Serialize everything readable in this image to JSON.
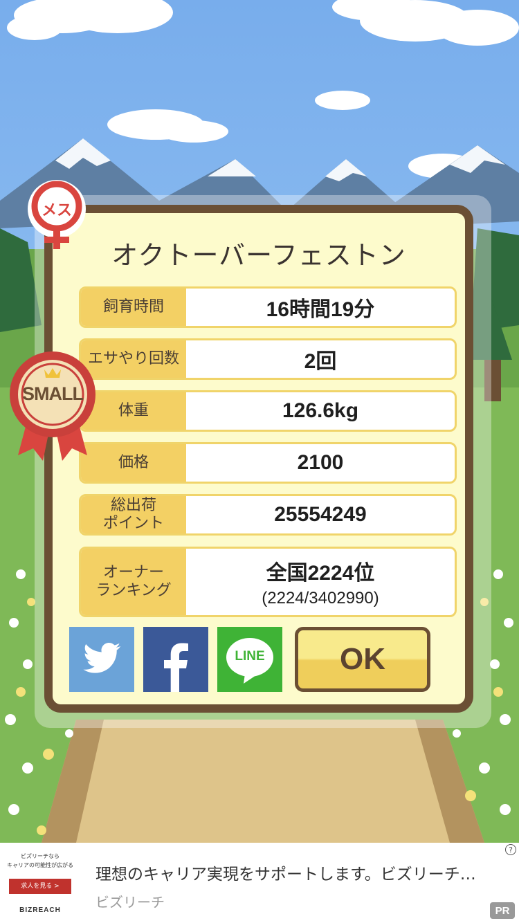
{
  "profile": {
    "name": "オクトーバーフェストン",
    "gender_badge": "メス",
    "size_badge": "SMALL"
  },
  "stats": {
    "breeding_time": {
      "label": "飼育時間",
      "value": "16時間19分"
    },
    "feed_count": {
      "label": "エサやり回数",
      "value": "2回"
    },
    "weight": {
      "label": "体重",
      "value": "126.6kg"
    },
    "price": {
      "label": "価格",
      "value": "2100"
    },
    "total_points": {
      "label_line1": "総出荷",
      "label_line2": "ポイント",
      "value": "25554249"
    },
    "ranking": {
      "label_line1": "オーナー",
      "label_line2": "ランキング",
      "value": "全国2224位",
      "detail": "(2224/3402990)"
    }
  },
  "share": {
    "twitter_icon": "twitter-bird-icon",
    "facebook_icon": "facebook-f-icon",
    "line_label": "LINE"
  },
  "ok_label": "OK",
  "ad": {
    "thumb_line1": "ビズリーチなら",
    "thumb_line2": "キャリアの可能性が広がる",
    "thumb_button": "求人を見る >",
    "thumb_logo": "BIZREACH",
    "title": "理想のキャリア実現をサポートします。ビズリーチ…",
    "sponsor": "ビズリーチ",
    "pr_label": "PR",
    "info_icon": "?"
  },
  "colors": {
    "panel_bg": "#fdfbcc",
    "panel_border": "#6b4f34",
    "label_bg": "#f3d064",
    "twitter": "#6ba3d8",
    "facebook": "#3b5998",
    "line": "#3fb336",
    "badge_red": "#d9453f"
  }
}
